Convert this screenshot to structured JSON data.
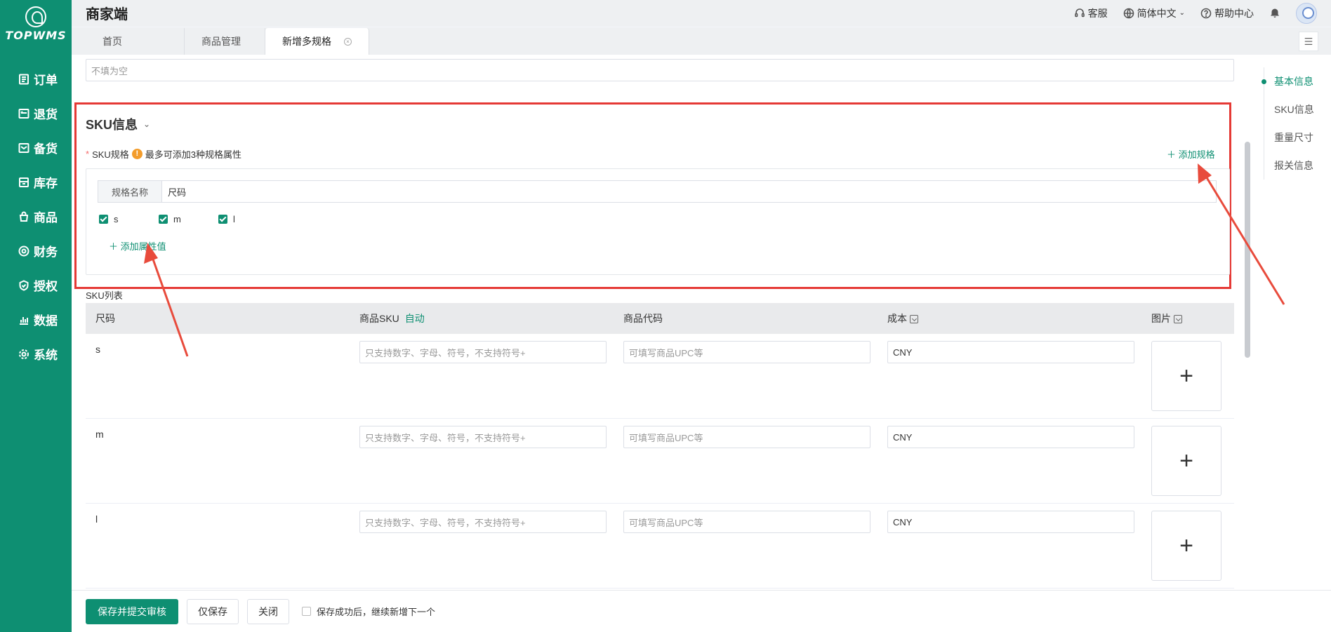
{
  "app": {
    "logo_text": "TOPWMS",
    "title": "商家端"
  },
  "sidebar": {
    "items": [
      {
        "label": "订单",
        "icon": "order-icon"
      },
      {
        "label": "退货",
        "icon": "return-icon"
      },
      {
        "label": "备货",
        "icon": "stock-prep-icon"
      },
      {
        "label": "库存",
        "icon": "inventory-icon"
      },
      {
        "label": "商品",
        "icon": "goods-icon"
      },
      {
        "label": "财务",
        "icon": "finance-icon"
      },
      {
        "label": "授权",
        "icon": "auth-icon"
      },
      {
        "label": "数据",
        "icon": "data-icon"
      },
      {
        "label": "系统",
        "icon": "system-icon"
      }
    ]
  },
  "header": {
    "service": "客服",
    "language": "简体中文",
    "help": "帮助中心"
  },
  "tabs": [
    {
      "label": "首页"
    },
    {
      "label": "商品管理"
    },
    {
      "label": "新增多规格"
    }
  ],
  "form": {
    "top_placeholder": "不填为空"
  },
  "sku": {
    "section_title": "SKU信息",
    "spec_label": "SKU规格",
    "spec_hint": "最多可添加3种规格属性",
    "add_spec": "添加规格",
    "spec_name_label": "规格名称",
    "spec_name_value": "尺码",
    "options": [
      "s",
      "m",
      "l"
    ],
    "add_attr": "添加属性值",
    "list_label": "SKU列表"
  },
  "table": {
    "headers": {
      "size": "尺码",
      "sku": "商品SKU",
      "auto": "自动",
      "code": "商品代码",
      "cost": "成本",
      "image": "图片"
    },
    "sku_placeholder": "只支持数字、字母、符号，不支持符号+",
    "code_placeholder": "可填写商品UPC等",
    "rows": [
      {
        "size": "s",
        "cost": "CNY"
      },
      {
        "size": "m",
        "cost": "CNY"
      },
      {
        "size": "l",
        "cost": "CNY"
      }
    ]
  },
  "anchors": [
    "基本信息",
    "SKU信息",
    "重量尺寸",
    "报关信息"
  ],
  "footer": {
    "submit": "保存并提交审核",
    "save": "仅保存",
    "close": "关闭",
    "continue": "保存成功后，继续新增下一个"
  },
  "colors": {
    "brand": "#0e8f72",
    "highlight": "#e53935"
  }
}
